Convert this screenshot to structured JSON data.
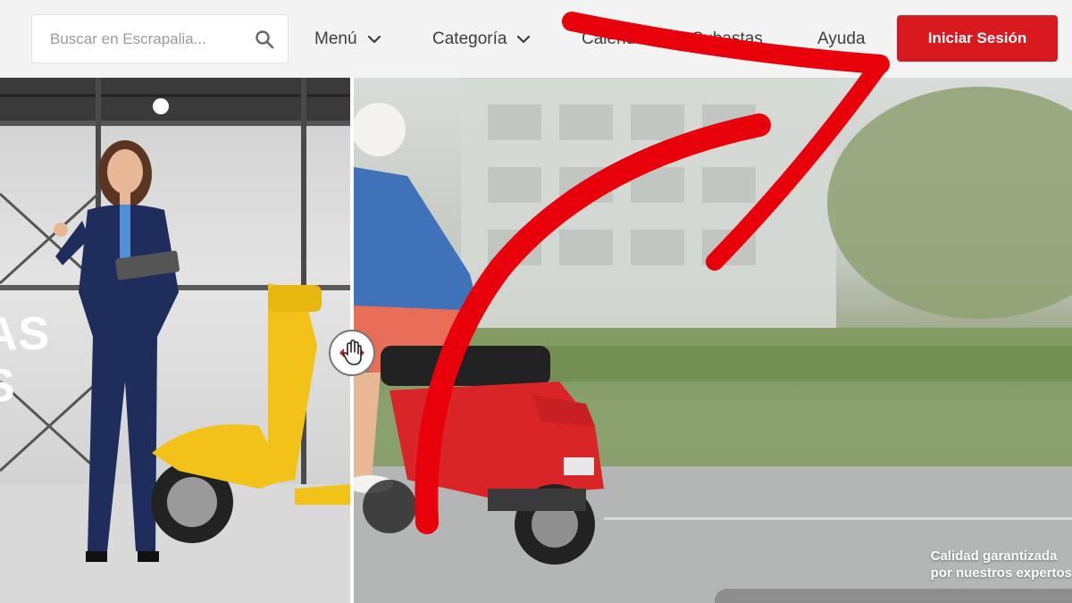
{
  "header": {
    "search": {
      "placeholder": "Buscar en Escrapalia...",
      "value": "",
      "icon": "search-icon"
    },
    "nav": {
      "menu_label": "Menú",
      "category_label": "Categoría",
      "auctions_label": "Calendario de Subastas",
      "help_label": "Ayuda"
    },
    "login_label": "Iniciar Sesión"
  },
  "hero": {
    "left_text": [
      "AS",
      "S"
    ],
    "quality_line1": "Calidad garantizada",
    "quality_line2": "por nuestros expertos",
    "compare_icon": "hand-drag-icon"
  },
  "colors": {
    "accent": "#d81920",
    "annotation_arrow": "#e8000b",
    "header_bg": "#f3f3f3",
    "text": "#3d3d3d"
  }
}
